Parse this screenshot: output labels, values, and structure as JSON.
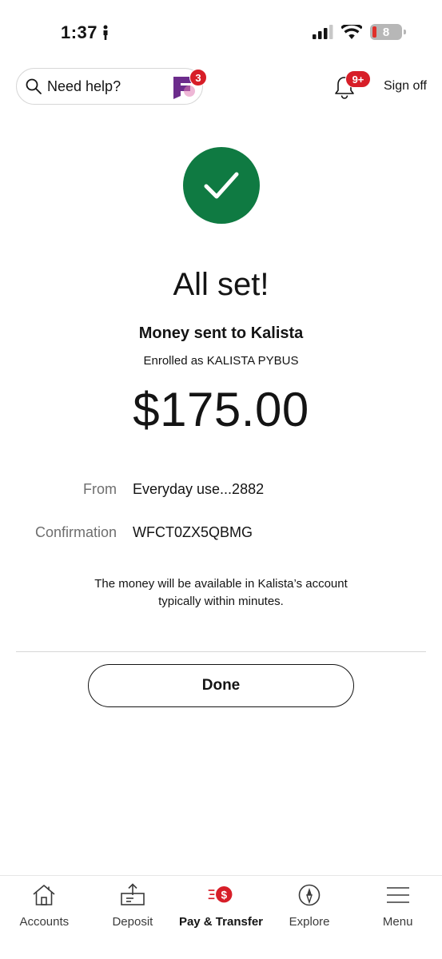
{
  "status_bar": {
    "time": "1:37",
    "battery": "8"
  },
  "header": {
    "search_placeholder": "Need help?",
    "assistant_badge": "3",
    "notifications_badge": "9+",
    "sign_off_label": "Sign off"
  },
  "confirmation": {
    "title": "All set!",
    "subtitle": "Money sent to Kalista",
    "enrolled": "Enrolled as KALISTA PYBUS",
    "amount": "$175.00",
    "details": [
      {
        "label": "From",
        "value": "Everyday use...2882"
      },
      {
        "label": "Confirmation",
        "value": "WFCT0ZX5QBMG"
      }
    ],
    "note_line1": "The money will be available in Kalista’s account",
    "note_line2": "typically within minutes.",
    "done_label": "Done"
  },
  "bottom_nav": {
    "items": [
      {
        "label": "Accounts",
        "icon": "home-icon"
      },
      {
        "label": "Deposit",
        "icon": "deposit-icon"
      },
      {
        "label": "Pay & Transfer",
        "icon": "pay-transfer-icon"
      },
      {
        "label": "Explore",
        "icon": "compass-icon"
      },
      {
        "label": "Menu",
        "icon": "menu-icon"
      }
    ]
  },
  "colors": {
    "brand_red": "#d71e28",
    "success_green": "#0f7a42",
    "assistant_purple": "#6c2c8c"
  }
}
